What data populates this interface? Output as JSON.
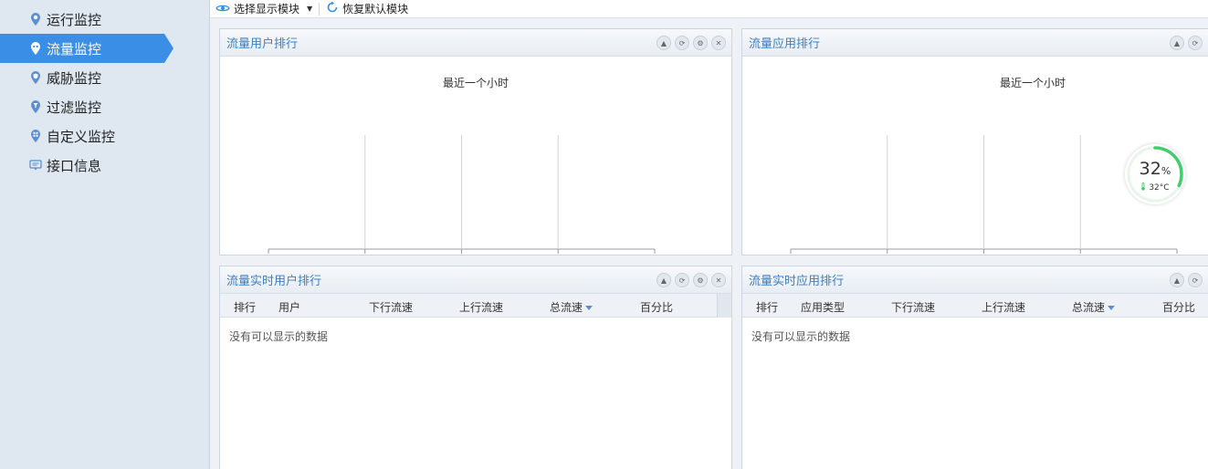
{
  "sidebar": {
    "items": [
      {
        "label": "运行监控",
        "icon": "run-monitor-icon",
        "active": false
      },
      {
        "label": "流量监控",
        "icon": "traffic-monitor-icon",
        "active": true
      },
      {
        "label": "威胁监控",
        "icon": "threat-monitor-icon",
        "active": false
      },
      {
        "label": "过滤监控",
        "icon": "filter-monitor-icon",
        "active": false
      },
      {
        "label": "自定义监控",
        "icon": "custom-monitor-icon",
        "active": false
      },
      {
        "label": "接口信息",
        "icon": "interface-info-icon",
        "active": false
      }
    ]
  },
  "toolbar": {
    "select_modules_label": "选择显示模块",
    "restore_default_label": "恢复默认模块"
  },
  "panels": {
    "user_rank": {
      "title": "流量用户排行",
      "subtitle": "最近一个小时"
    },
    "app_rank": {
      "title": "流量应用排行",
      "subtitle": "最近一个小时"
    },
    "realtime_user": {
      "title": "流量实时用户排行",
      "columns": [
        "排行",
        "用户",
        "下行流速",
        "上行流速",
        "总流速",
        "百分比"
      ],
      "empty_text": "没有可以显示的数据"
    },
    "realtime_app": {
      "title": "流量实时应用排行",
      "columns": [
        "排行",
        "应用类型",
        "下行流速",
        "上行流速",
        "总流速",
        "百分比"
      ],
      "empty_text": "没有可以显示的数据"
    }
  },
  "chart_data": [
    {
      "type": "bar",
      "orientation": "horizontal",
      "title": "最近一个小时",
      "categories": [],
      "values": [],
      "x_ticks": [
        "0B",
        "0.2B",
        "0.5B",
        "0.7B",
        "1B"
      ],
      "xlim": [
        0,
        1
      ],
      "grid": true
    },
    {
      "type": "bar",
      "orientation": "horizontal",
      "title": "最近一个小时",
      "categories": [],
      "values": [],
      "x_ticks": [
        "0B",
        "0.2B",
        "0.5B",
        "0.7B",
        "1B"
      ],
      "xlim": [
        0,
        1
      ],
      "grid": true
    }
  ],
  "gauge": {
    "value": "32",
    "unit": "%",
    "fraction": 0.32,
    "temp": "32°C"
  },
  "colors": {
    "accent": "#3a8ee6",
    "title": "#3b7fc4",
    "gauge": "#3ecf6a"
  }
}
